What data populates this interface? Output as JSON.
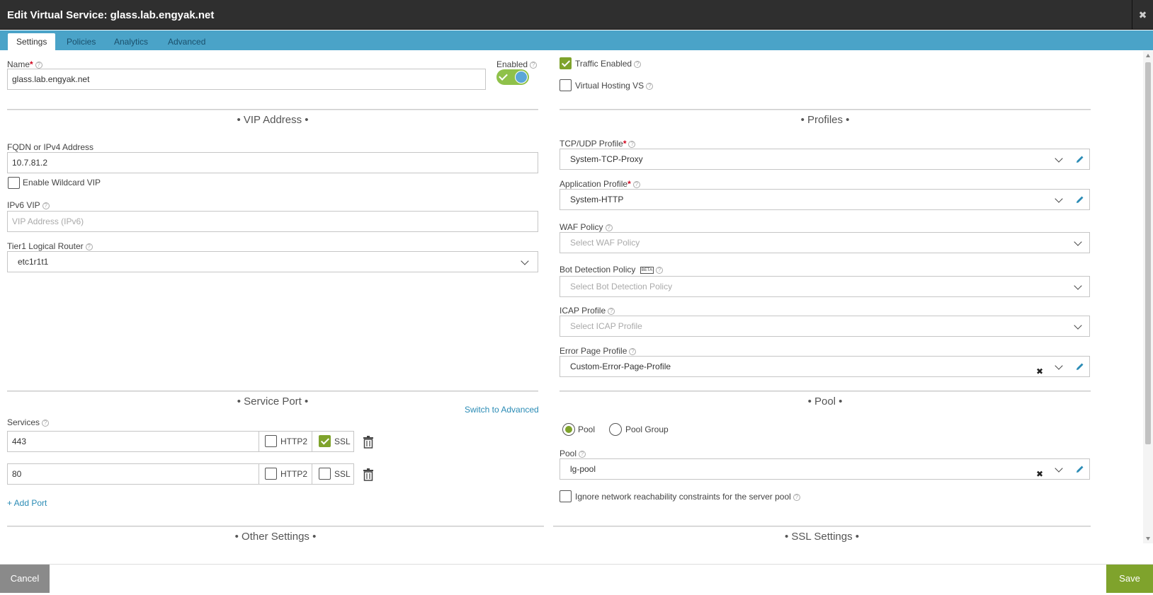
{
  "window": {
    "title": "Edit Virtual Service: glass.lab.engyak.net",
    "close_glyph": "✖"
  },
  "tabs": [
    {
      "label": "Settings",
      "active": true
    },
    {
      "label": "Policies"
    },
    {
      "label": "Analytics"
    },
    {
      "label": "Advanced"
    }
  ],
  "name_field": {
    "label": "Name",
    "value": "glass.lab.engyak.net"
  },
  "enabled": {
    "label": "Enabled",
    "on": true
  },
  "traffic_enabled": {
    "label": "Traffic Enabled",
    "checked": true
  },
  "virtual_hosting": {
    "label": "Virtual Hosting VS",
    "checked": false
  },
  "vip": {
    "section_title": "• VIP Address •",
    "fqdn_label": "FQDN or IPv4 Address",
    "fqdn_value": "10.7.81.2",
    "wildcard_label": "Enable Wildcard VIP",
    "ipv6_label": "IPv6 VIP",
    "ipv6_placeholder": "VIP Address (IPv6)",
    "router_label": "Tier1 Logical Router",
    "router_value": "etc1r1t1"
  },
  "profiles": {
    "section_title": "• Profiles •",
    "tcp_label": "TCP/UDP Profile",
    "tcp_value": "System-TCP-Proxy",
    "app_label": "Application Profile",
    "app_value": "System-HTTP",
    "waf_label": "WAF Policy",
    "waf_placeholder": "Select WAF Policy",
    "bot_label": "Bot Detection Policy",
    "bot_badge": "BETA",
    "bot_placeholder": "Select Bot Detection Policy",
    "icap_label": "ICAP Profile",
    "icap_placeholder": "Select ICAP Profile",
    "error_label": "Error Page Profile",
    "error_value": "Custom-Error-Page-Profile"
  },
  "service_port": {
    "section_title": "• Service Port •",
    "switch_link": "Switch to Advanced",
    "services_label": "Services",
    "rows": [
      {
        "port": "443",
        "http2_label": "HTTP2",
        "http2": false,
        "ssl_label": "SSL",
        "ssl": true
      },
      {
        "port": "80",
        "http2_label": "HTTP2",
        "http2": false,
        "ssl_label": "SSL",
        "ssl": false
      }
    ],
    "add_port": "+ Add Port"
  },
  "pool": {
    "section_title": "• Pool •",
    "radio_pool": "Pool",
    "radio_group": "Pool Group",
    "pool_label": "Pool",
    "pool_value": "lg-pool",
    "ignore_label": "Ignore network reachability constraints for the server pool"
  },
  "other_settings": {
    "section_title": "• Other Settings •"
  },
  "ssl_settings": {
    "section_title": "• SSL Settings •"
  },
  "footer": {
    "cancel": "Cancel",
    "save": "Save"
  },
  "colors": {
    "titlebar": "#2f2f2f",
    "tabbar": "#4aa3c8",
    "accent_green": "#7fa32c",
    "link": "#2a8bb5"
  }
}
